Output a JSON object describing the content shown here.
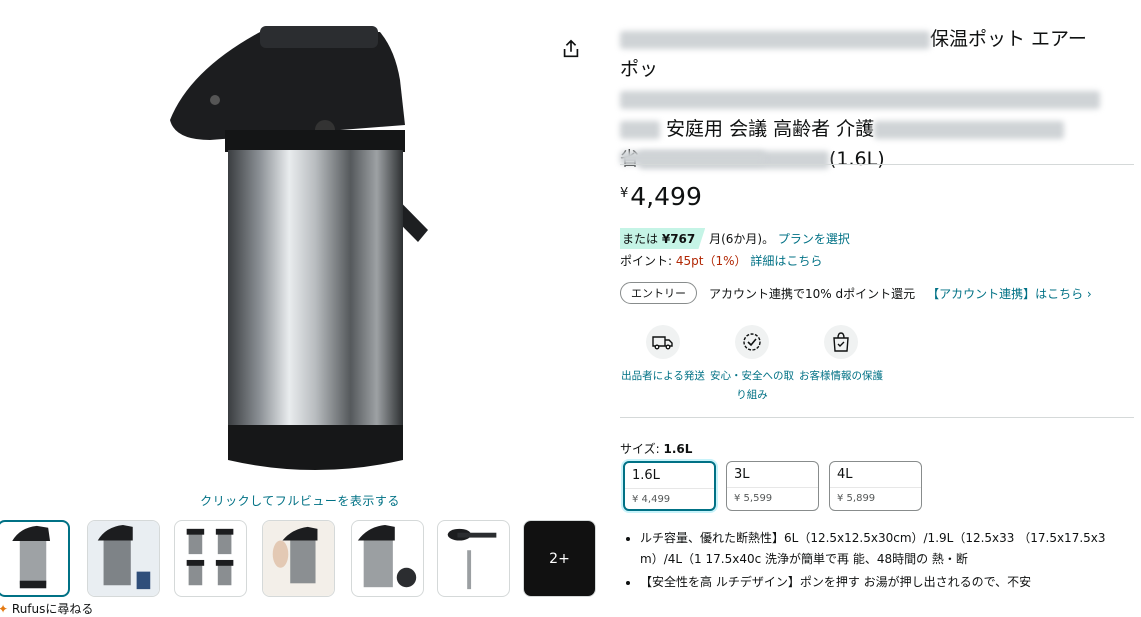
{
  "gallery": {
    "fullview_label": "クリックしてフルビューを表示する",
    "thumbnails": [
      "thumb-1",
      "thumb-2",
      "thumb-3",
      "thumb-4",
      "thumb-5",
      "thumb-6"
    ],
    "more_label": "2+"
  },
  "rufus_label": "Rufusに尋ねる",
  "product": {
    "title_visible_lines": [
      "保温ポット エアー",
      "ポッ",
      "安庭用 会議 高齢者 介護",
      "省",
      "(1.6L)"
    ],
    "price_currency": "¥",
    "price": "4,499",
    "installment_prefix": "または",
    "installment_amount": "¥767",
    "installment_suffix": "月(6か月)。",
    "installment_link": "プランを選択",
    "points_label": "ポイント:",
    "points_value": "45pt（1%）",
    "points_link": "詳細はこちら",
    "entry_button": "エントリー",
    "campaign_text": "アカウント連携で10% dポイント還元",
    "campaign_link": "【アカウント連携】はこちら ›"
  },
  "badges": [
    {
      "icon": "truck-icon",
      "label": "出品者による発送"
    },
    {
      "icon": "shield-check-icon",
      "label": "安心・安全への取り組み"
    },
    {
      "icon": "bag-lock-icon",
      "label": "お客様情報の保護"
    }
  ],
  "size": {
    "label": "サイズ:",
    "selected": "1.6L",
    "options": [
      {
        "name": "1.6L",
        "price": "¥ 4,499"
      },
      {
        "name": "3L",
        "price": "¥ 5,599"
      },
      {
        "name": "4L",
        "price": "¥ 5,899"
      }
    ]
  },
  "bullets": [
    "ルチ容量、優れた断熱性】6L（12.5x12.5x30cm）/1.9L（12.5x33 （17.5x17.5x3 m）/4L（1 17.5x40c 洗浄が簡単で再 能、48時間の 熱・断",
    "【安全性を高 ルチデザイン】ポンを押す お湯が押し出されるので、不安"
  ],
  "colors": {
    "link": "#007185",
    "price_red": "#b12704",
    "badge_green": "#c5f4e6",
    "selected_border": "#007185"
  }
}
